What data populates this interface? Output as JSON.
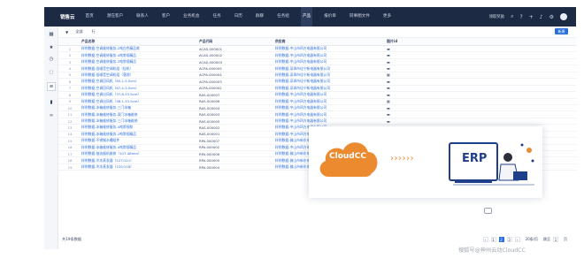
{
  "nav": {
    "brand": "销售云",
    "items": [
      "首页",
      "潜在客户",
      "联系人",
      "客户",
      "业务机会",
      "任务",
      "日历",
      "群聊",
      "任务组",
      "产品",
      "报价单",
      "同事圈文件",
      "更多"
    ],
    "active_index": 9,
    "right_link": "领取奖励"
  },
  "toolbar": {
    "filter_label": "全部",
    "select_label": "行",
    "new_label": "新建"
  },
  "table": {
    "columns": [
      "",
      "产品名称",
      "产品代码",
      "供应商",
      "图片id"
    ],
    "rows": [
      {
        "idx": "1",
        "name": "样例数据-空调维修服务-2吨白色精品款",
        "code": "ACAS-000001",
        "supplier": "样例数据-中山市四方电器有限公司",
        "img": "▬"
      },
      {
        "idx": "2",
        "name": "样例数据-空调维修服务-4吨常规精品",
        "code": "ACAS-000002",
        "supplier": "样例数据-中山市四方电器有限公司",
        "img": "▬"
      },
      {
        "idx": "3",
        "name": "样例数据-空调维修服务-2吨常规精品",
        "code": "ACAS-000003",
        "supplier": "样例数据-中山市四方电器有限公司",
        "img": "▬"
      },
      {
        "idx": "4",
        "name": "样例数据-低噪音空调机组（挂机）",
        "code": "ACPA-000005",
        "supplier": "样例数据-深圳市佳宁新电器有限公司",
        "img": "▬"
      },
      {
        "idx": "5",
        "name": "样例数据-低噪音空调机组（落地）",
        "code": "ACPA-000004",
        "supplier": "样例数据-深圳市佳宁新电器有限公司",
        "img": "▦"
      },
      {
        "idx": "6",
        "name": "样例数据-空调回风机（85.2-3.5cm）",
        "code": "ACPA-000003",
        "supplier": "样例数据-深圳市佳宁新电器有限公司",
        "img": "▬"
      },
      {
        "idx": "7",
        "name": "样例数据-空调回风机（87.4-3.5cm）",
        "code": "ACPA-000002",
        "supplier": "样例数据-深圳市佳宁新电器有限公司",
        "img": "▬"
      },
      {
        "idx": "8",
        "name": "样例数据-空调出风机（37.8-33.5cm）",
        "code": "RAS-000007",
        "supplier": "样例数据-中山市四方电器有限公司",
        "img": "▬"
      },
      {
        "idx": "9",
        "name": "样例数据-空调出风机（38.1-33.5cm）",
        "code": "RAS-000006",
        "supplier": "样例数据-中山市四方电器有限公司",
        "img": "▦"
      },
      {
        "idx": "10",
        "name": "样例数据-冰箱维修服务-三门冰箱",
        "code": "RAS-000004",
        "supplier": "样例数据-中山市四方电器有限公司",
        "img": "▬"
      },
      {
        "idx": "11",
        "name": "样例数据-冰箱维修服务-双门冰箱维修",
        "code": "RAS-000003",
        "supplier": "样例数据-中山市四方电器有限公司",
        "img": "▬"
      },
      {
        "idx": "12",
        "name": "样例数据-冰箱维修服务-三门冰箱维修",
        "code": "RAS-000005",
        "supplier": "样例数据-中山市四方电器有限公司",
        "img": "▬"
      },
      {
        "idx": "13",
        "name": "样例数据-冰箱维修服务-4吨常规款",
        "code": "RAS-000002",
        "supplier": "样例数据-中山市四方电器有限公司",
        "img": "▬"
      },
      {
        "idx": "14",
        "name": "样例数据-冰箱维修服务-2吨常规精品",
        "code": "RAS-000001",
        "supplier": "样例数据-中山市四方电器有限公司",
        "img": "▬"
      },
      {
        "idx": "15",
        "name": "样例数据-不锈钢水槽组件",
        "code": "RPA-000007",
        "supplier": "样例数据-佛山市新东电器有限公司",
        "img": "▬"
      },
      {
        "idx": "16",
        "name": "样例数据-冰箱维修服务-4吨常规精品",
        "code": "RPA-000002",
        "supplier": "样例数据-中山市四方电器有限公司",
        "img": "▬"
      },
      {
        "idx": "17",
        "name": "样例数据-抽油烟机维修（107-48mm）",
        "code": "RPA-000006",
        "supplier": "样例数据-佛山市新东电器有限公司",
        "img": "▬"
      },
      {
        "idx": "18",
        "name": "样例数据-冷冻蒸发器（127/121）",
        "code": "RPA-000005",
        "supplier": "样例数据-佛山市新东电器有限公司",
        "img": "▦"
      },
      {
        "idx": "19",
        "name": "样例数据-冷冻蒸发器（120/118）",
        "code": "RPA-000004",
        "supplier": "样例数据-佛山市新东电器有限公司",
        "img": "▦"
      }
    ]
  },
  "footer": {
    "total": "共19条数据",
    "pages": [
      "‹",
      "1",
      "2",
      "3",
      "›"
    ],
    "current_page": "2",
    "page_size": "20条/页",
    "goto_label": "跳至",
    "goto_value": "1",
    "page_unit": "页"
  },
  "overlay": {
    "left_label": "CloudCC",
    "arrows": "››››››",
    "right_label": "ERP",
    "cloud_color": "#ec8a30",
    "erp_color": "#1f3f8a"
  },
  "watermark": "搜狐号@神州云动CloudCC",
  "colors": {
    "nav_bg": "#1c2a44",
    "link": "#2b6fdc",
    "accent": "#2b6fdc"
  }
}
